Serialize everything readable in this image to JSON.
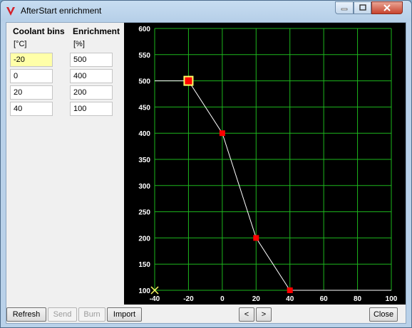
{
  "window": {
    "title": "AfterStart enrichment"
  },
  "table": {
    "col1_header": "Coolant bins",
    "col1_unit": "[°C]",
    "col2_header": "Enrichment",
    "col2_unit": "[%]",
    "rows": [
      {
        "coolant": "-20",
        "enrichment": "500"
      },
      {
        "coolant": "0",
        "enrichment": "400"
      },
      {
        "coolant": "20",
        "enrichment": "200"
      },
      {
        "coolant": "40",
        "enrichment": "100"
      }
    ],
    "active_row": 0
  },
  "buttons": {
    "refresh": "Refresh",
    "send": "Send",
    "burn": "Burn",
    "import": "Import",
    "prev": "<",
    "next": ">",
    "close": "Close"
  },
  "colors": {
    "chart_bg": "#000000",
    "grid": "#1db61d",
    "line": "#ffffff",
    "point": "#ff0000",
    "selected_border": "#ffff66",
    "cursor": "#ffff66",
    "active_cell": "#ffffa8"
  },
  "chart_data": {
    "type": "line",
    "xlim": [
      -40,
      100
    ],
    "ylim": [
      100,
      600
    ],
    "x_ticks": [
      -40,
      -20,
      0,
      20,
      40,
      60,
      80,
      100
    ],
    "y_ticks": [
      100,
      150,
      200,
      250,
      300,
      350,
      400,
      450,
      500,
      550,
      600
    ],
    "grid": true,
    "series": [
      {
        "x": [
          -20,
          0,
          20,
          40
        ],
        "y": [
          500,
          400,
          200,
          100
        ]
      }
    ],
    "selected_index": 0,
    "cursor": {
      "x": -40,
      "y": 100
    }
  }
}
